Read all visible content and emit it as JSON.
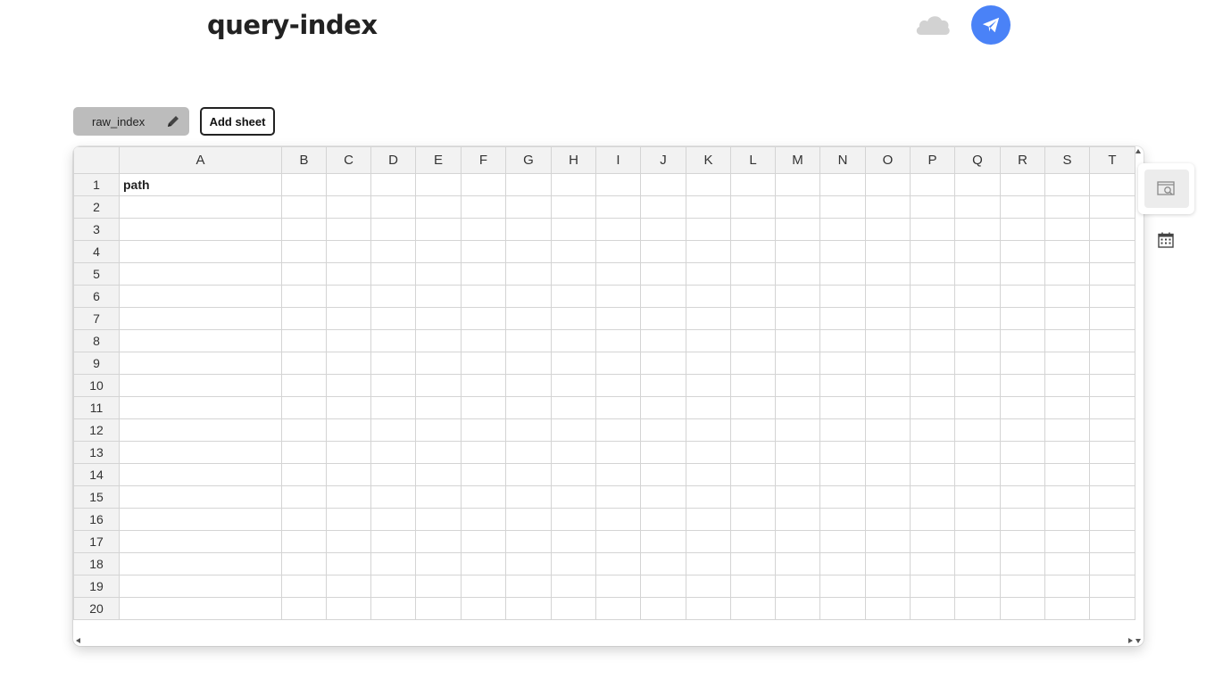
{
  "header": {
    "title": "query-index",
    "cloud_icon": "cloud-icon",
    "publish_icon": "paper-plane-icon",
    "publish_color": "#4a82f7"
  },
  "sheets": {
    "tabs": [
      {
        "label": "raw_index",
        "edit_icon": "pencil-icon",
        "selected": true
      }
    ],
    "add_label": "Add sheet"
  },
  "grid": {
    "columns": [
      "A",
      "B",
      "C",
      "D",
      "E",
      "F",
      "G",
      "H",
      "I",
      "J",
      "K",
      "L",
      "M",
      "N",
      "O",
      "P",
      "Q",
      "R",
      "S",
      "T"
    ],
    "rows": [
      "1",
      "2",
      "3",
      "4",
      "5",
      "6",
      "7",
      "8",
      "9",
      "10",
      "11",
      "12",
      "13",
      "14",
      "15",
      "16",
      "17",
      "18",
      "19",
      "20"
    ],
    "cells": {
      "A1": "path"
    }
  },
  "side_tools": {
    "preview_icon": "search-preview-icon",
    "calendar_icon": "calendar-icon"
  }
}
